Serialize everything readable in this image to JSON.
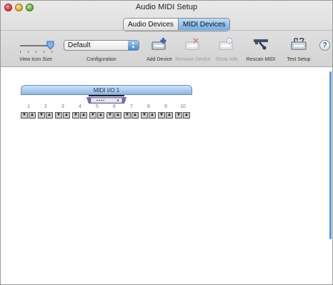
{
  "window": {
    "title": "Audio MIDI Setup"
  },
  "tabs": [
    {
      "label": "Audio Devices",
      "active": false
    },
    {
      "label": "MIDI Devices",
      "active": true
    }
  ],
  "toolbar": {
    "view_icon_size_label": "View Icon Size",
    "configuration_label": "Configuration",
    "configuration_value": "Default",
    "add_device_label": "Add Device",
    "remove_device_label": "Remove Device",
    "show_info_label": "Show Info",
    "rescan_midi_label": "Rescan MIDI",
    "test_setup_label": "Test Setup",
    "help_label": "?"
  },
  "device": {
    "name": "MIDI I/O 1",
    "ports": [
      {
        "number": "1",
        "in": "▼",
        "out": "▲"
      },
      {
        "number": "2",
        "in": "▼",
        "out": "▲"
      },
      {
        "number": "3",
        "in": "▼",
        "out": "▲"
      },
      {
        "number": "4",
        "in": "▼",
        "out": "▲"
      },
      {
        "number": "5",
        "in": "▼",
        "out": "▲"
      },
      {
        "number": "6",
        "in": "▼",
        "out": "▲"
      },
      {
        "number": "7",
        "in": "▼",
        "out": "▲"
      },
      {
        "number": "8",
        "in": "▼",
        "out": "▲"
      },
      {
        "number": "9",
        "in": "▼",
        "out": "▲"
      },
      {
        "number": "10",
        "in": "▼",
        "out": "▲"
      }
    ]
  },
  "colors": {
    "accent": "#6aaae6",
    "device_header": "#8bb8e6"
  },
  "icons": [
    "close-icon",
    "minimize-icon",
    "zoom-icon",
    "slider-knob-icon",
    "add-device-icon",
    "remove-device-icon",
    "show-info-icon",
    "rescan-midi-icon",
    "test-setup-icon",
    "midi-interface-icon"
  ]
}
